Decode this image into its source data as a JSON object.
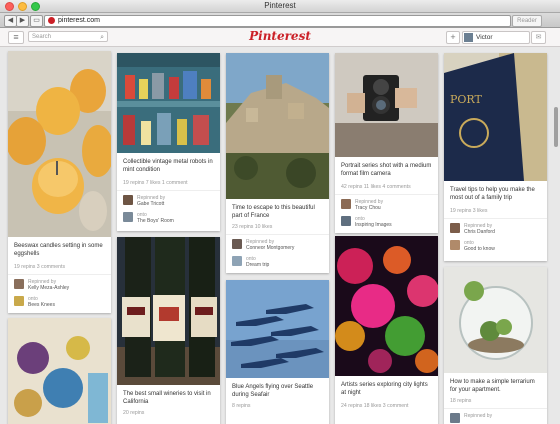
{
  "window": {
    "title": "Pinterest"
  },
  "browser": {
    "url": "pinterest.com",
    "reader_label": "Reader",
    "back": "◀",
    "forward": "▶",
    "tabs_icon": "▭"
  },
  "header": {
    "logo": "Pinterest",
    "search_placeholder": "Search",
    "search_icon": "search-icon",
    "menu_icon": "≡",
    "add_icon": "+",
    "user_name": "Victor",
    "messages_icon": "💬"
  },
  "pins": [
    {
      "desc": "Beeswax candles setting in some eggshells",
      "stats": "19 repins   3 comments",
      "by_label": "Repinned by",
      "by_name": "Kelly Meza-Ashley",
      "onto_label": "onto",
      "board": "Bees Knees"
    },
    {
      "desc": "Collectible vintage metal robots in mint condition",
      "stats": "19 repins   7 likes   1 comment",
      "by_label": "Repinned by",
      "by_name": "Gabe Tricott",
      "onto_label": "onto",
      "board": "The Boys' Room"
    },
    {
      "desc": "The best small wineries to visit in California",
      "stats": "20 repins"
    },
    {
      "desc": "Time to escape to this beautiful part of France",
      "stats": "23 repins   10 likes",
      "by_label": "Repinned by",
      "by_name": "Conneor Montgomery",
      "onto_label": "onto",
      "board": "Dream trip"
    },
    {
      "desc": "Blue Angels flying over Seattle during Seafair",
      "stats": "8 repins"
    },
    {
      "desc": "Portrait series shot with a medium format film camera",
      "stats": "42 repins   11 likes   4 comments",
      "by_label": "Repinned by",
      "by_name": "Tracy Chou",
      "onto_label": "onto",
      "board": "Inspiring Images"
    },
    {
      "desc": "Artists series exploring city lights at night",
      "stats": "24 repins   18 likes   3 comment"
    },
    {
      "desc": "Travel tips to help you make the most out of a family trip",
      "stats": "19 repins   3 likes",
      "by_label": "Repinned by",
      "by_name": "Chris Danford",
      "onto_label": "onto",
      "board": "Good to know"
    },
    {
      "desc": "How to make a simple terrarium for your apartment.",
      "stats": "18 repins",
      "by_label": "Repinned by"
    }
  ],
  "colors": {
    "brand": "#cb2027",
    "background": "#e8e8e8"
  }
}
